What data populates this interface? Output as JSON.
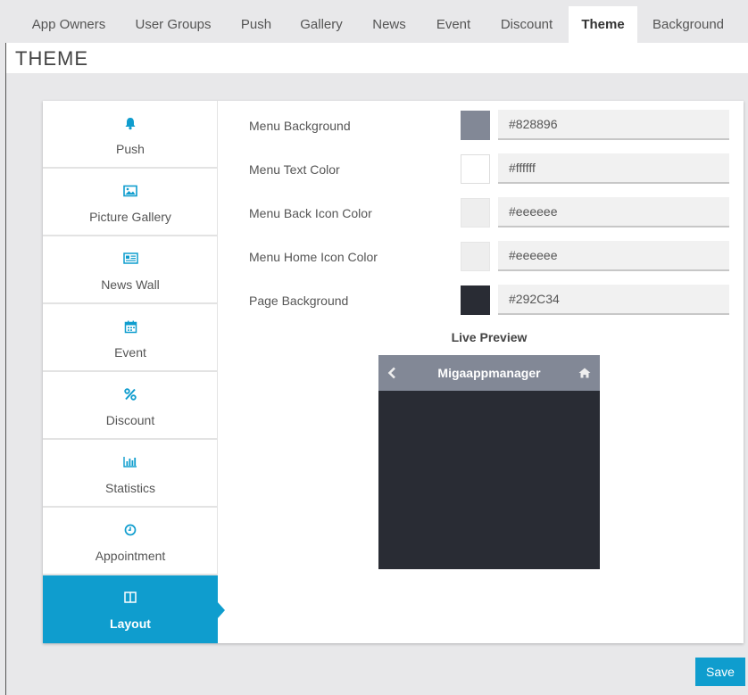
{
  "tabs": [
    {
      "label": "App Owners",
      "active": false
    },
    {
      "label": "User Groups",
      "active": false
    },
    {
      "label": "Push",
      "active": false
    },
    {
      "label": "Gallery",
      "active": false
    },
    {
      "label": "News",
      "active": false
    },
    {
      "label": "Event",
      "active": false
    },
    {
      "label": "Discount",
      "active": false
    },
    {
      "label": "Theme",
      "active": true
    },
    {
      "label": "Background",
      "active": false
    }
  ],
  "page_title": "THEME",
  "sidebar": {
    "items": [
      {
        "label": "Push",
        "icon": "bell-icon"
      },
      {
        "label": "Picture Gallery",
        "icon": "picture-icon"
      },
      {
        "label": "News Wall",
        "icon": "newspaper-icon"
      },
      {
        "label": "Event",
        "icon": "calendar-icon"
      },
      {
        "label": "Discount",
        "icon": "percent-icon"
      },
      {
        "label": "Statistics",
        "icon": "bar-chart-icon"
      },
      {
        "label": "Appointment",
        "icon": "clock-icon"
      },
      {
        "label": "Layout",
        "icon": "columns-icon",
        "active": true
      }
    ]
  },
  "theme_settings": [
    {
      "label": "Menu Background",
      "value": "#828896",
      "swatch": "#828896"
    },
    {
      "label": "Menu Text Color",
      "value": "#ffffff",
      "swatch": "#ffffff"
    },
    {
      "label": "Menu Back Icon Color",
      "value": "#eeeeee",
      "swatch": "#eeeeee"
    },
    {
      "label": "Menu Home Icon Color",
      "value": "#eeeeee",
      "swatch": "#eeeeee"
    },
    {
      "label": "Page Background",
      "value": "#292C34",
      "swatch": "#292C34"
    }
  ],
  "preview": {
    "title": "Live Preview",
    "app_name": "Migaappmanager"
  },
  "save_label": "Save",
  "colors": {
    "accent": "#0f9dce",
    "menu_bg": "#828896",
    "page_bg": "#292c34"
  }
}
